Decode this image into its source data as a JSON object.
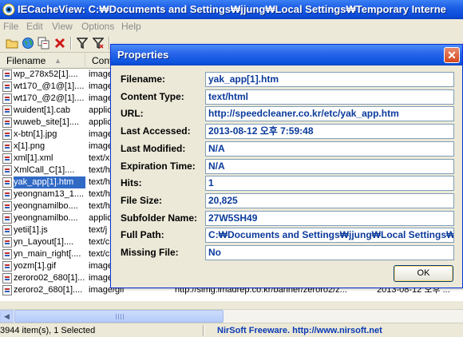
{
  "window": {
    "title": "IECacheView:  C:₩Documents and Settings₩jjung₩Local Settings₩Temporary Interne"
  },
  "menu": [
    "File",
    "Edit",
    "View",
    "Options",
    "Help"
  ],
  "columns": {
    "filename": "Filename",
    "content_type": "Cont"
  },
  "rows": [
    {
      "filename": "wp_278x52[1]....",
      "type": "image"
    },
    {
      "filename": "wt170_@1@[1]....",
      "type": "image"
    },
    {
      "filename": "wt170_@2@[1]....",
      "type": "image"
    },
    {
      "filename": "wuident[1].cab",
      "type": "applic"
    },
    {
      "filename": "wuweb_site[1]....",
      "type": "applic"
    },
    {
      "filename": "x-btn[1].jpg",
      "type": "image"
    },
    {
      "filename": "x[1].png",
      "type": "image"
    },
    {
      "filename": "xml[1].xml",
      "type": "text/x"
    },
    {
      "filename": "XmlCall_C[1]....",
      "type": "text/h"
    },
    {
      "filename": "yak_app[1].htm",
      "type": "text/h"
    },
    {
      "filename": "yeongnam13_1....",
      "type": "text/h"
    },
    {
      "filename": "yeongnamilbo....",
      "type": "text/h"
    },
    {
      "filename": "yeongnamilbo....",
      "type": "applic"
    },
    {
      "filename": "yetii[1].js",
      "type": "text/j"
    },
    {
      "filename": "yn_Layout[1]....",
      "type": "text/c"
    },
    {
      "filename": "yn_main_right[....",
      "type": "text/c"
    },
    {
      "filename": "yozm[1].gif",
      "type": "image"
    },
    {
      "filename": "zeroro02_680[1]...",
      "type": "image"
    },
    {
      "filename": "zeroro2_680[1]....",
      "type": "image/gif",
      "url": "http://simg.imadrep.co.kr/banner/zeroro2/z...",
      "last": "2013-08-12 오후 ..."
    }
  ],
  "selected_row_index": 9,
  "status": {
    "items": "3944 item(s), 1 Selected",
    "credit": "NirSoft Freeware.  http://www.nirsoft.net"
  },
  "dialog": {
    "title": "Properties",
    "close_glyph": "✕",
    "ok_label": "OK",
    "properties": [
      {
        "label": "Filename:",
        "value": "yak_app[1].htm"
      },
      {
        "label": "Content Type:",
        "value": "text/html"
      },
      {
        "label": "URL:",
        "value": "http://speedcleaner.co.kr/etc/yak_app.htm"
      },
      {
        "label": "Last Accessed:",
        "value": "2013-08-12 오후 7:59:48"
      },
      {
        "label": "Last Modified:",
        "value": "N/A"
      },
      {
        "label": "Expiration Time:",
        "value": "N/A"
      },
      {
        "label": "Hits:",
        "value": "1"
      },
      {
        "label": "File Size:",
        "value": "20,825"
      },
      {
        "label": "Subfolder Name:",
        "value": "27W5SH49"
      },
      {
        "label": "Full Path:",
        "value": "C:₩Documents and Settings₩jjung₩Local Settings₩Te"
      },
      {
        "label": "Missing File:",
        "value": "No"
      }
    ]
  },
  "icons": {
    "app": "eye-icon",
    "toolbar": [
      "open-folder-icon",
      "globe-icon",
      "copy-icon",
      "delete-icon",
      "filter-icon",
      "filter-red-icon",
      "page-icon",
      "page-icon",
      "page-icon",
      "folder-icon",
      "page-icon",
      "page-icon"
    ]
  }
}
